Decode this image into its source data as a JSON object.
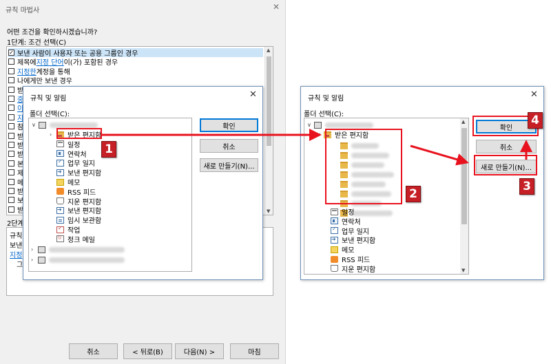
{
  "wizard": {
    "title": "규칙 마법사",
    "question": "어떤 조건을 확인하시겠습니까?",
    "step1_label": "1단계: 조건 선택(C)",
    "conditions": [
      {
        "checked": true,
        "pre": "보낸 사람이 사용자 또는 공용 그룹인 경우",
        "link": "",
        "post": ""
      },
      {
        "checked": false,
        "pre": "제목에 ",
        "link": "지정 단어",
        "post": "이(가) 포함된 경우"
      },
      {
        "checked": false,
        "pre": "",
        "link": "지정한",
        "post": " 계정을 통해"
      },
      {
        "checked": false,
        "pre": "나에게만 보낸 경우",
        "link": "",
        "post": ""
      },
      {
        "checked": false,
        "pre": "받",
        "link": "",
        "post": ""
      },
      {
        "checked": false,
        "pre": "",
        "link": "중",
        "post": ""
      },
      {
        "checked": false,
        "pre": "",
        "link": "이",
        "post": ""
      },
      {
        "checked": false,
        "pre": "",
        "link": "지",
        "post": ""
      },
      {
        "checked": false,
        "pre": "참",
        "link": "",
        "post": ""
      },
      {
        "checked": false,
        "pre": "받",
        "link": "",
        "post": ""
      },
      {
        "checked": false,
        "pre": "받",
        "link": "",
        "post": ""
      },
      {
        "checked": false,
        "pre": "받",
        "link": "",
        "post": ""
      },
      {
        "checked": false,
        "pre": "본",
        "link": "",
        "post": ""
      },
      {
        "checked": false,
        "pre": "제",
        "link": "",
        "post": ""
      },
      {
        "checked": false,
        "pre": "메",
        "link": "",
        "post": ""
      },
      {
        "checked": false,
        "pre": "받",
        "link": "",
        "post": ""
      },
      {
        "checked": false,
        "pre": "보",
        "link": "",
        "post": ""
      },
      {
        "checked": false,
        "pre": "받",
        "link": "",
        "post": ""
      }
    ],
    "step2_label": "2단계",
    "desc_lines": [
      "규칙",
      "보낸",
      "지정",
      "그"
    ],
    "buttons": {
      "cancel": "취소",
      "back": "< 뒤로(B)",
      "next": "다음(N) >",
      "finish": "마침"
    }
  },
  "dialog1": {
    "title": "규칙 및 알림",
    "close": "✕",
    "folder_label": "폴더 선택(C):",
    "folders": [
      {
        "icon": "inbox-icon",
        "label": "받은 편지함"
      },
      {
        "icon": "calendar-icon",
        "label": "일정"
      },
      {
        "icon": "contacts-icon",
        "label": "연락처"
      },
      {
        "icon": "journal-icon",
        "label": "업무 일지"
      },
      {
        "icon": "sent-icon",
        "label": "보낸 편지함"
      },
      {
        "icon": "notes-icon",
        "label": "메모"
      },
      {
        "icon": "rss-icon",
        "label": "RSS 피드"
      },
      {
        "icon": "trash-icon",
        "label": "지운 편지함"
      },
      {
        "icon": "outbox-icon",
        "label": "보낸 편지함"
      },
      {
        "icon": "drafts-icon",
        "label": "임시 보관함"
      },
      {
        "icon": "tasks-icon",
        "label": "작업"
      },
      {
        "icon": "junk-icon",
        "label": "정크 메일"
      }
    ],
    "buttons": {
      "ok": "확인",
      "cancel": "취소",
      "new": "새로 만들기(N)..."
    }
  },
  "dialog2": {
    "title": "규칙 및 알림",
    "close": "✕",
    "folder_label": "폴더 선택(C):",
    "root_folder": {
      "icon": "inbox-icon",
      "label": "받은 편지함"
    },
    "folders": [
      {
        "icon": "calendar-icon",
        "label": "일정"
      },
      {
        "icon": "contacts-icon",
        "label": "연락처"
      },
      {
        "icon": "journal-icon",
        "label": "업무 일지"
      },
      {
        "icon": "sent-icon",
        "label": "보낸 편지함"
      },
      {
        "icon": "notes-icon",
        "label": "메모"
      },
      {
        "icon": "rss-icon",
        "label": "RSS 피드"
      },
      {
        "icon": "trash-icon",
        "label": "지운 편지함"
      }
    ],
    "buttons": {
      "ok": "확인",
      "cancel": "취소",
      "new": "새로 만들기(N)..."
    }
  },
  "badges": [
    "1",
    "2",
    "3",
    "4"
  ],
  "colors": {
    "annotation_red": "#e8121e",
    "badge_red": "#c62026",
    "selection": "#cce4f7",
    "link": "#0066cc"
  }
}
